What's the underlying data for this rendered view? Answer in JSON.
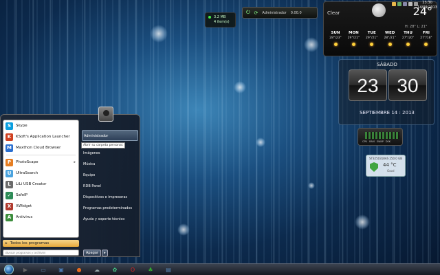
{
  "gadgets": {
    "mini": {
      "line1": "3.2 MB",
      "line2": "4 item(s)"
    },
    "bar": {
      "label": "Administrador",
      "value": "0.00.0"
    }
  },
  "weather": {
    "condition": "Clear",
    "temperature": "24°",
    "hilo": "H: 28° L: 21°",
    "forecast": [
      {
        "day": "SUN",
        "temps": "28°/23°"
      },
      {
        "day": "MON",
        "temps": "29°/21°"
      },
      {
        "day": "TUE",
        "temps": "29°/21°"
      },
      {
        "day": "WED",
        "temps": "28°/21°"
      },
      {
        "day": "THU",
        "temps": "27°/20°"
      },
      {
        "day": "FRI",
        "temps": "27°/18°"
      }
    ]
  },
  "clock": {
    "dayname": "SÁBADO",
    "hour": "23",
    "minute": "30",
    "date": "SEPTIEMBRE 14 : 2013"
  },
  "sysmon": {
    "labels": [
      "CPU",
      "RAM",
      "SWAP",
      "DSK"
    ]
  },
  "disk": {
    "header": "ST3250318AS 250.0 GB",
    "temp": "44 °C",
    "status": "Good"
  },
  "start_menu": {
    "apps": [
      {
        "label": "Skype",
        "color": "#0a9fe0",
        "glyph": "S"
      },
      {
        "label": "KSoft's Application Launcher",
        "color": "#d04020",
        "glyph": "K"
      },
      {
        "label": "Maxthon Cloud Browser",
        "color": "#2a6fd0",
        "glyph": "M"
      },
      {
        "label": "PhotoScape",
        "color": "#e67e22",
        "glyph": "P",
        "arrow": "▸"
      },
      {
        "label": "UltraSearch",
        "color": "#4aa3df",
        "glyph": "U"
      },
      {
        "label": "LiLi USB Creator",
        "color": "#6b6b6b",
        "glyph": "L"
      },
      {
        "label": "SafeIP",
        "color": "#2e8b57",
        "glyph": "✓"
      },
      {
        "label": "XWidget",
        "color": "#b03a2e",
        "glyph": "X"
      },
      {
        "label": "Antivirus",
        "color": "#3c8d3c",
        "glyph": "A"
      }
    ],
    "all_programs": "Todos los programas",
    "search_placeholder": "Buscar programas y archivos",
    "right_items": [
      "Administrador",
      "Imágenes",
      "Música",
      "Equipo",
      "RDB Panel",
      "Dispositivos e impresoras",
      "Programas predeterminados",
      "Ayuda y soporte técnico"
    ],
    "tooltip": "Abrir su carpeta personal.",
    "shutdown": "Apagar",
    "shutdown_arrow": "▸"
  },
  "taskbar": {
    "apps": [
      {
        "name": "media-player-icon",
        "glyph": "▶",
        "color": "#666"
      },
      {
        "name": "window-icon",
        "glyph": "▭",
        "color": "#5b7fa6"
      },
      {
        "name": "computer-icon",
        "glyph": "▣",
        "color": "#4a79b0"
      },
      {
        "name": "firefox-icon",
        "glyph": "●",
        "color": "#e56b1f"
      },
      {
        "name": "cloud-icon",
        "glyph": "☁",
        "color": "#9aa"
      },
      {
        "name": "app-icon",
        "glyph": "✿",
        "color": "#4c8"
      },
      {
        "name": "opera-icon",
        "glyph": "O",
        "color": "#d22"
      },
      {
        "name": "clover-icon",
        "glyph": "♣",
        "color": "#3a3"
      },
      {
        "name": "explorer-icon",
        "glyph": "▤",
        "color": "#5a88b8"
      }
    ],
    "time": "23:30",
    "date": "14/09/2013"
  }
}
